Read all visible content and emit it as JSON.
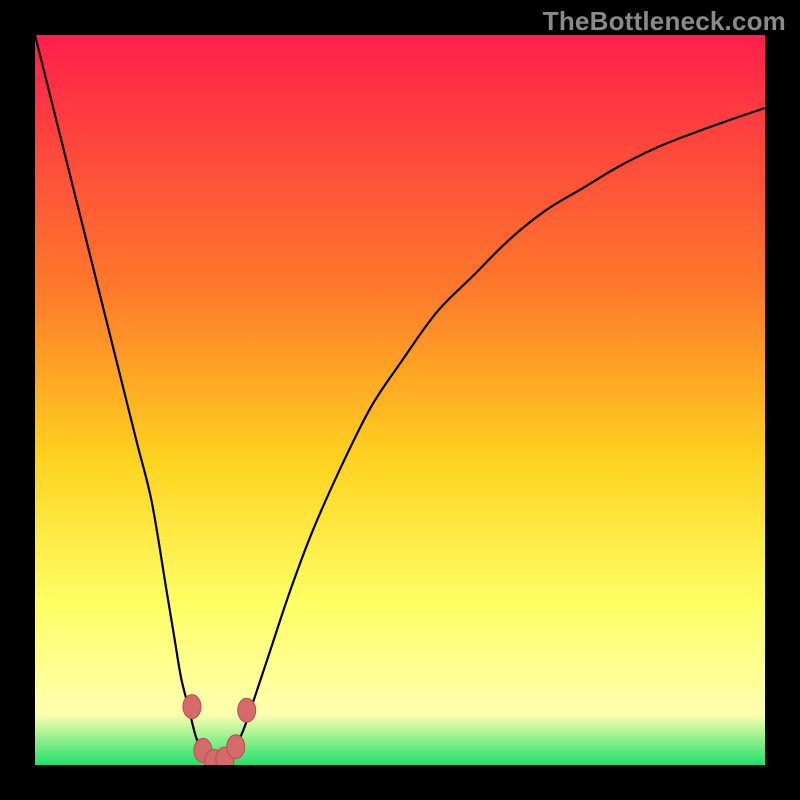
{
  "watermark": "TheBottleneck.com",
  "colors": {
    "frame": "#000000",
    "gradient_top": "#ff1f4b",
    "gradient_mid1": "#ff7a2a",
    "gradient_mid2": "#ffd21f",
    "gradient_mid3": "#ffff66",
    "gradient_mid4": "#ffffb0",
    "gradient_bottom": "#22e06b",
    "curve": "#000000",
    "marker_fill": "#d46a6a",
    "marker_stroke": "#b94e4e"
  },
  "chart_data": {
    "type": "line",
    "title": "",
    "xlabel": "",
    "ylabel": "",
    "xlim": [
      0,
      100
    ],
    "ylim": [
      0,
      100
    ],
    "series": [
      {
        "name": "bottleneck-curve",
        "x": [
          0,
          2,
          4,
          6,
          8,
          10,
          12,
          14,
          16,
          18,
          19,
          20,
          21,
          22,
          23,
          24,
          25,
          26,
          27,
          28,
          29,
          30,
          32,
          35,
          38,
          42,
          46,
          50,
          55,
          60,
          65,
          70,
          75,
          80,
          85,
          90,
          95,
          100
        ],
        "y": [
          100,
          92,
          84,
          76,
          68,
          60,
          52,
          44,
          36,
          24,
          18,
          12,
          8,
          4,
          1.5,
          0.5,
          0.3,
          0.5,
          1.5,
          3.5,
          6,
          9,
          15,
          24,
          32,
          41,
          49,
          55,
          62,
          67,
          72,
          76,
          79,
          82,
          84.5,
          86.5,
          88.3,
          90
        ]
      }
    ],
    "markers": [
      {
        "x": 21.5,
        "y": 8.0
      },
      {
        "x": 23.0,
        "y": 2.0
      },
      {
        "x": 24.5,
        "y": 0.5
      },
      {
        "x": 26.0,
        "y": 0.8
      },
      {
        "x": 27.5,
        "y": 2.5
      },
      {
        "x": 29.0,
        "y": 7.5
      }
    ],
    "min_point": {
      "x": 25,
      "y": 0.3
    }
  }
}
